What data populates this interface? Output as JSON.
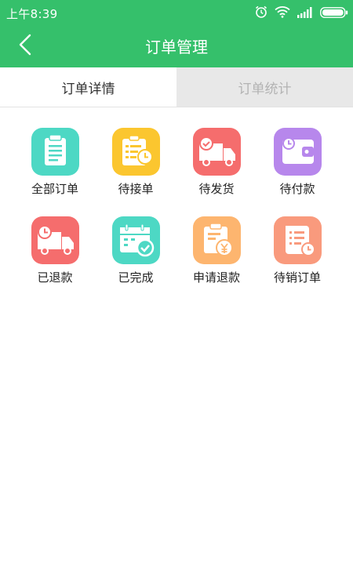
{
  "status_bar": {
    "time": "上午8:39"
  },
  "header": {
    "title": "订单管理"
  },
  "tabs": [
    {
      "label": "订单详情",
      "active": true
    },
    {
      "label": "订单统计",
      "active": false
    }
  ],
  "grid_items": [
    {
      "label": "全部订单",
      "icon": "clipboard-list-icon",
      "color": "#4dd8c4"
    },
    {
      "label": "待接单",
      "icon": "checklist-clock-icon",
      "color": "#fbc62f"
    },
    {
      "label": "待发货",
      "icon": "delivery-truck-check-icon",
      "color": "#f56d6d"
    },
    {
      "label": "待付款",
      "icon": "wallet-clock-icon",
      "color": "#b787ec"
    },
    {
      "label": "已退款",
      "icon": "delivery-truck-clock-icon",
      "color": "#f56d6d"
    },
    {
      "label": "已完成",
      "icon": "calendar-check-icon",
      "color": "#4dd8c4"
    },
    {
      "label": "申请退款",
      "icon": "clipboard-yen-icon",
      "color": "#fdb56f"
    },
    {
      "label": "待销订单",
      "icon": "document-clock-icon",
      "color": "#f99a7d"
    }
  ]
}
